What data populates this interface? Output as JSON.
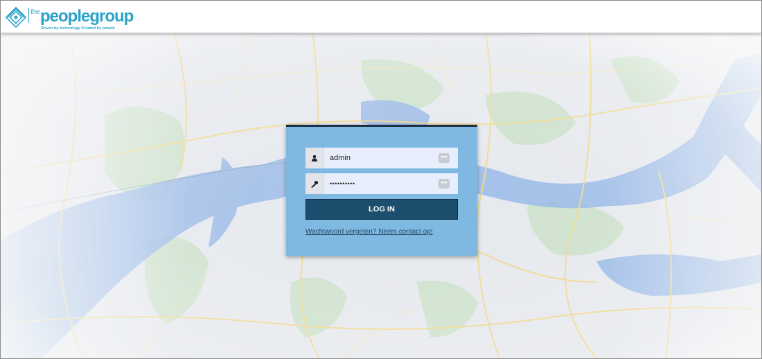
{
  "header": {
    "logo_prefix": "the",
    "logo_name": "peoplegroup",
    "logo_tagline": "Driven by technology Created by people"
  },
  "login": {
    "username_value": "admin",
    "password_value": "••••••••••",
    "password_reveal_label": "•••",
    "username_reveal_label": "•••",
    "submit_label": "LOG IN",
    "forgot_link": "Wachtwoord vergeten? Neem contact op!"
  },
  "colors": {
    "brand": "#2ba3c9",
    "panel": "#7fb9e2",
    "button": "#1d4e6e",
    "map_water": "#8fb3e6",
    "map_land": "#e6e9ee",
    "map_green": "#c9e0c8",
    "map_road": "#f1d58a"
  },
  "icons": {
    "user": "user-icon",
    "key": "key-icon",
    "dots": "more-dots-icon",
    "logo": "diamond-logo-icon"
  }
}
